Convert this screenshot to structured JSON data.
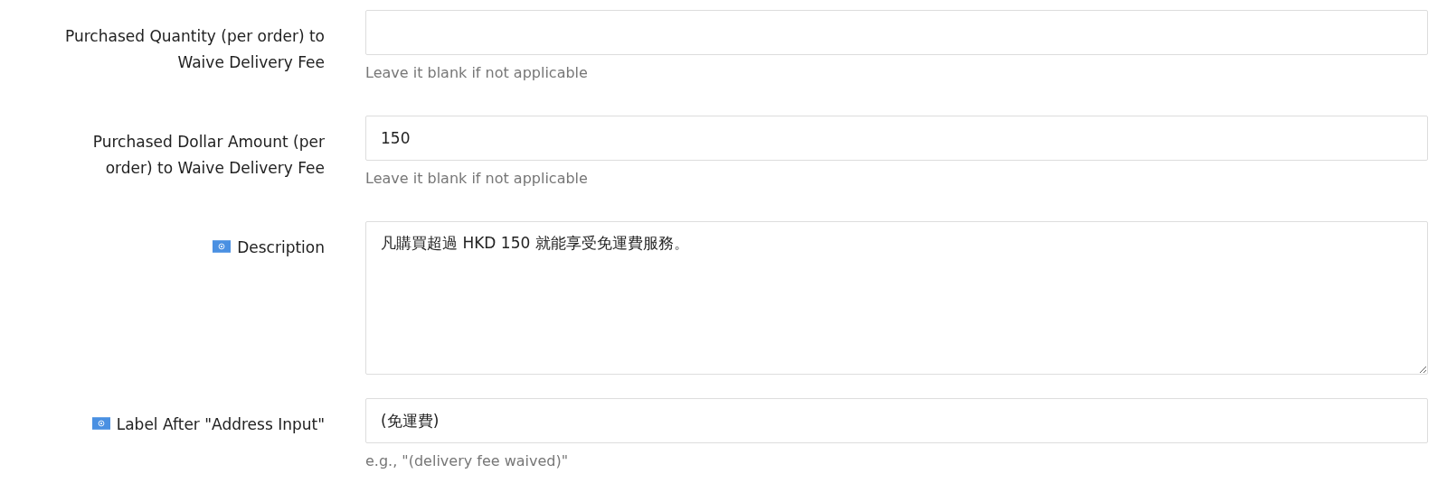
{
  "fields": [
    {
      "kind": "input",
      "label_lines": [
        "Purchased Quantity (per order) to",
        "Waive Delivery Fee"
      ],
      "flag": false,
      "help": "Leave it blank if not applicable"
    },
    {
      "kind": "input",
      "label_lines": [
        "Purchased Dollar Amount (per",
        "order) to Waive Delivery Fee"
      ],
      "flag": false,
      "value": "150",
      "help": "Leave it blank if not applicable"
    },
    {
      "kind": "textarea",
      "label_lines": [
        "Description"
      ],
      "flag": true,
      "value": "凡購買超過 HKD 150 就能享受免運費服務。"
    },
    {
      "kind": "input",
      "label_lines": [
        "Label After \"Address Input\""
      ],
      "flag": true,
      "value": "(免運費)",
      "help": "e.g., \"(delivery fee waived)\""
    }
  ]
}
